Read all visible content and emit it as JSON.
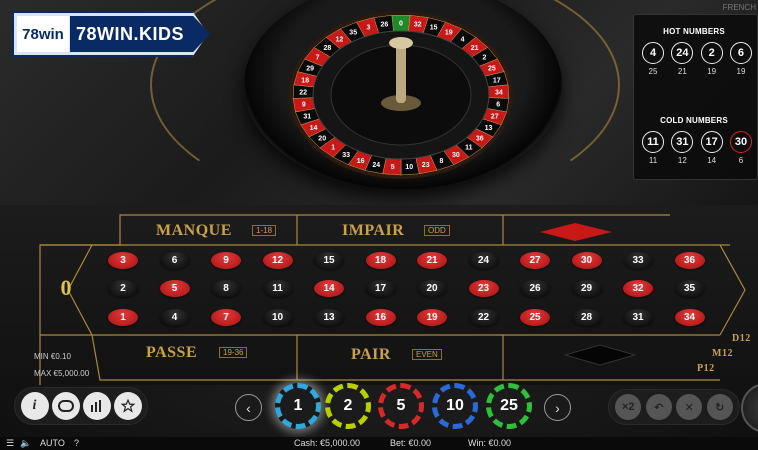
{
  "logo": {
    "badge": "78win",
    "name": "78WIN.KIDS"
  },
  "game_name": "FRENCH",
  "stats": {
    "hot_title": "HOT NUMBERS",
    "hot": [
      {
        "n": "4",
        "c": "25",
        "color": "black"
      },
      {
        "n": "24",
        "c": "21",
        "color": "black"
      },
      {
        "n": "2",
        "c": "19",
        "color": "black"
      },
      {
        "n": "6",
        "c": "19",
        "color": "black"
      }
    ],
    "cold_title": "COLD NUMBERS",
    "cold": [
      {
        "n": "11",
        "c": "11",
        "color": "black"
      },
      {
        "n": "31",
        "c": "12",
        "color": "black"
      },
      {
        "n": "17",
        "c": "14",
        "color": "black"
      },
      {
        "n": "30",
        "c": "6",
        "color": "red"
      }
    ]
  },
  "table": {
    "manque": "MANQUE",
    "manque_sub": "1-18",
    "impair": "IMPAIR",
    "impair_sub": "ODD",
    "passe": "PASSE",
    "passe_sub": "19-36",
    "pair": "PAIR",
    "pair_sub": "EVEN",
    "zero": "0",
    "dozens": [
      "D12",
      "M12",
      "P12"
    ],
    "rows": [
      [
        {
          "n": "3",
          "c": "red"
        },
        {
          "n": "6",
          "c": "black"
        },
        {
          "n": "9",
          "c": "red"
        },
        {
          "n": "12",
          "c": "red"
        },
        {
          "n": "15",
          "c": "black"
        },
        {
          "n": "18",
          "c": "red"
        },
        {
          "n": "21",
          "c": "red"
        },
        {
          "n": "24",
          "c": "black"
        },
        {
          "n": "27",
          "c": "red"
        },
        {
          "n": "30",
          "c": "red"
        },
        {
          "n": "33",
          "c": "black"
        },
        {
          "n": "36",
          "c": "red"
        }
      ],
      [
        {
          "n": "2",
          "c": "black"
        },
        {
          "n": "5",
          "c": "red"
        },
        {
          "n": "8",
          "c": "black"
        },
        {
          "n": "11",
          "c": "black"
        },
        {
          "n": "14",
          "c": "red"
        },
        {
          "n": "17",
          "c": "black"
        },
        {
          "n": "20",
          "c": "black"
        },
        {
          "n": "23",
          "c": "red"
        },
        {
          "n": "26",
          "c": "black"
        },
        {
          "n": "29",
          "c": "black"
        },
        {
          "n": "32",
          "c": "red"
        },
        {
          "n": "35",
          "c": "black"
        }
      ],
      [
        {
          "n": "1",
          "c": "red"
        },
        {
          "n": "4",
          "c": "black"
        },
        {
          "n": "7",
          "c": "red"
        },
        {
          "n": "10",
          "c": "black"
        },
        {
          "n": "13",
          "c": "black"
        },
        {
          "n": "16",
          "c": "red"
        },
        {
          "n": "19",
          "c": "red"
        },
        {
          "n": "22",
          "c": "black"
        },
        {
          "n": "25",
          "c": "red"
        },
        {
          "n": "28",
          "c": "black"
        },
        {
          "n": "31",
          "c": "black"
        },
        {
          "n": "34",
          "c": "red"
        }
      ]
    ],
    "min": "MIN €0.10",
    "max": "MAX €5,000.00"
  },
  "wheel_numbers": [
    "0",
    "32",
    "15",
    "19",
    "4",
    "21",
    "2",
    "25",
    "17",
    "34",
    "6",
    "27",
    "13",
    "36",
    "11",
    "30",
    "8",
    "23",
    "10",
    "5",
    "24",
    "16",
    "33",
    "1",
    "20",
    "14",
    "31",
    "9",
    "22",
    "18",
    "29",
    "7",
    "28",
    "12",
    "35",
    "3",
    "26"
  ],
  "controls": {
    "info_icon": "i",
    "chips": [
      {
        "v": "1",
        "color": "#2fa8e0"
      },
      {
        "v": "2",
        "color": "#b8d000"
      },
      {
        "v": "5",
        "color": "#d82828"
      },
      {
        "v": "10",
        "color": "#2a6ad8"
      },
      {
        "v": "25",
        "color": "#2fbf3a"
      }
    ],
    "prev": "‹",
    "next": "›",
    "double": "×2",
    "undo": "↶",
    "clear": "✕",
    "rebet": "↻"
  },
  "status": {
    "auto": "AUTO",
    "help": "?",
    "cash": "Cash: €5,000.00",
    "bet": "Bet: €0.00",
    "win": "Win: €0.00"
  },
  "colors": {
    "red": "#c81818",
    "black": "#0a0a0a",
    "green": "#1f8a2a",
    "gold": "#a98a3a"
  }
}
